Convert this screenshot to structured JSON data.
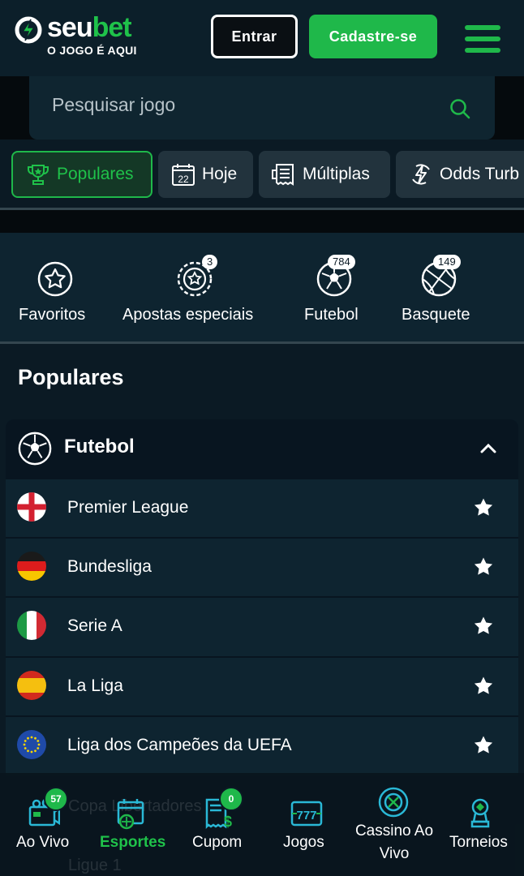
{
  "header": {
    "logo_word_1": "seu",
    "logo_word_2": "bet",
    "logo_tagline": "O JOGO É AQUI",
    "login_label": "Entrar",
    "signup_label": "Cadastre-se"
  },
  "search": {
    "placeholder": "Pesquisar jogo"
  },
  "quick_tabs": [
    {
      "label": "Populares",
      "icon": "trophy-icon",
      "active": true
    },
    {
      "label": "Hoje",
      "icon": "calendar-icon",
      "day": "22"
    },
    {
      "label": "Múltiplas",
      "icon": "ticket-icon"
    },
    {
      "label": "Odds Turb",
      "icon": "lightning-icon"
    }
  ],
  "categories": [
    {
      "label": "Favoritos",
      "icon": "star-circle-icon"
    },
    {
      "label": "Apostas especiais",
      "icon": "special-chip-icon",
      "count": "3"
    },
    {
      "label": "Futebol",
      "icon": "soccer-ball-icon",
      "count": "784"
    },
    {
      "label": "Basquete",
      "icon": "basketball-icon",
      "count": "149"
    }
  ],
  "populares": {
    "title": "Populares",
    "sport": "Futebol",
    "leagues": [
      {
        "label": "Premier League",
        "flag": "england"
      },
      {
        "label": "Bundesliga",
        "flag": "germany"
      },
      {
        "label": "Serie A",
        "flag": "italy"
      },
      {
        "label": "La Liga",
        "flag": "spain"
      },
      {
        "label": "Liga dos Campeões da UEFA",
        "flag": "eu"
      }
    ],
    "hidden_rows": [
      "Copa Libertadores",
      "Ligue 1"
    ]
  },
  "bottom_nav": [
    {
      "label": "Ao Vivo",
      "icon": "live-tv-icon",
      "badge": "57"
    },
    {
      "label": "Esportes",
      "icon": "sports-calendar-icon",
      "active": true
    },
    {
      "label": "Cupom",
      "icon": "coupon-icon",
      "badge": "0"
    },
    {
      "label": "Jogos",
      "icon": "slots-777-icon"
    },
    {
      "label": "Cassino Ao Vivo",
      "icon": "roulette-icon"
    },
    {
      "label": "Torneios",
      "icon": "tournament-trophy-icon"
    }
  ],
  "colors": {
    "brand_green": "#1fb84a",
    "background": "#0b1a24",
    "panel": "#0e2430"
  }
}
